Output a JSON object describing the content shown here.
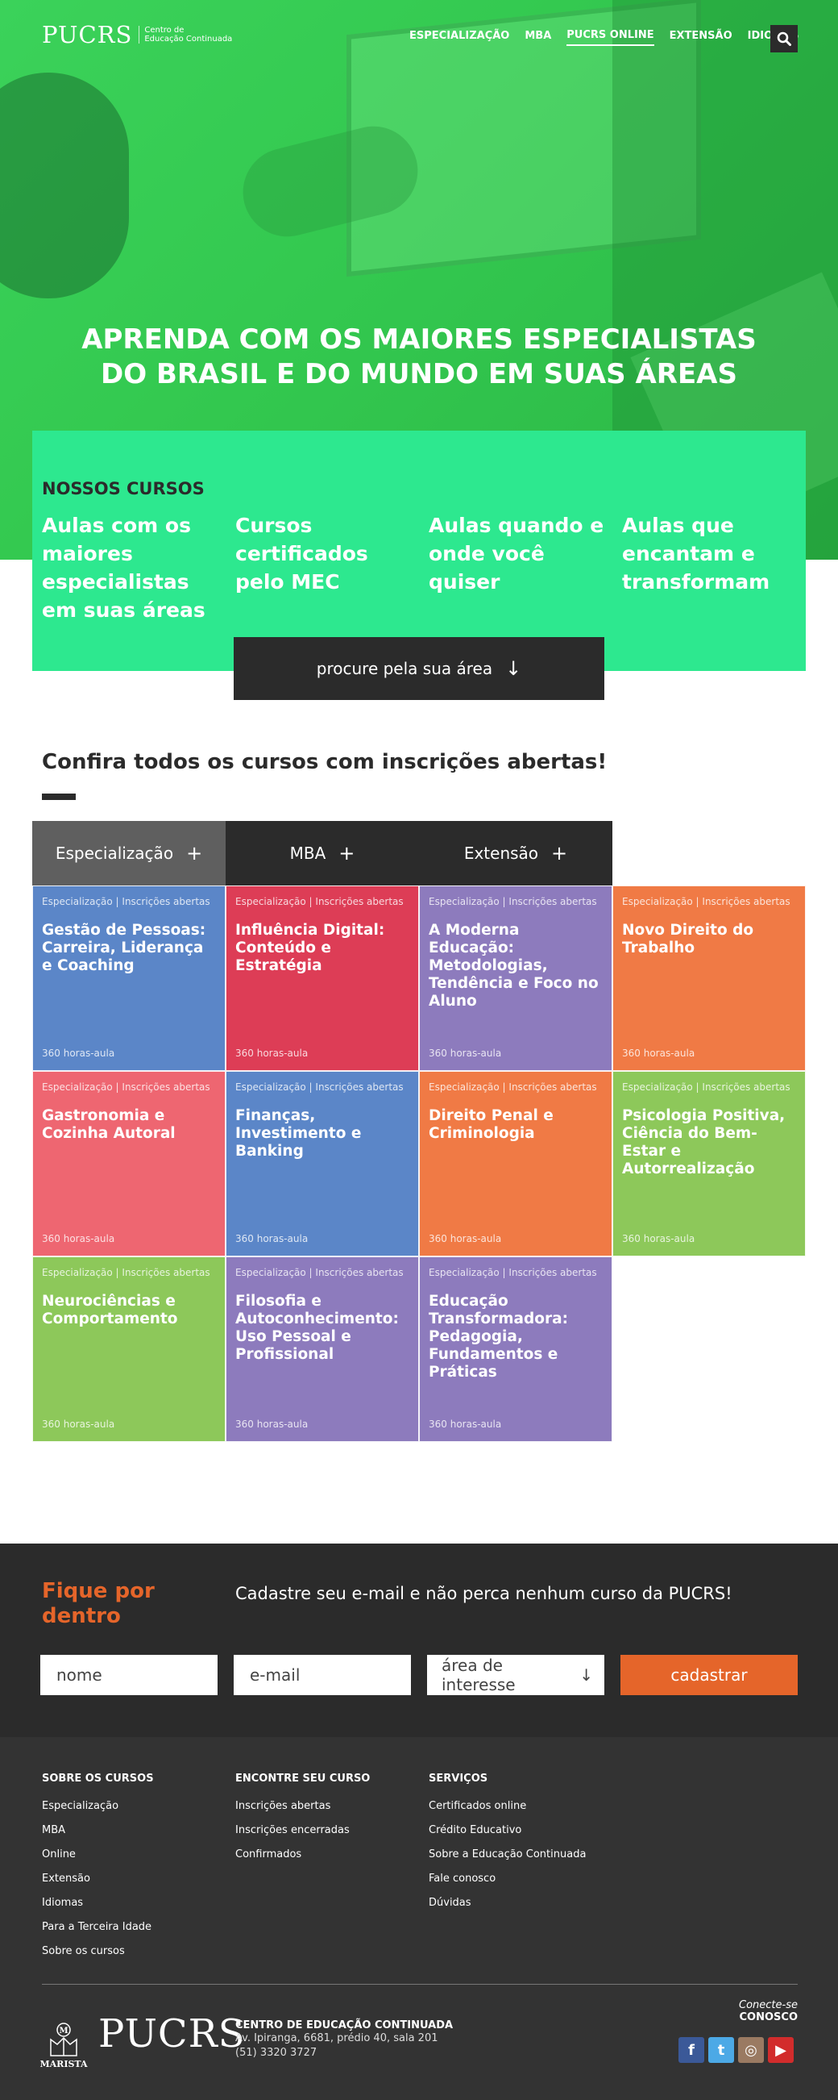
{
  "brand": {
    "name": "PUCRS",
    "sub_line1": "Centro de",
    "sub_line2": "Educação Continuada"
  },
  "nav": {
    "items": [
      "ESPECIALIZAÇÃO",
      "MBA",
      "PUCRS ONLINE",
      "EXTENSÃO",
      "IDIOMAS"
    ],
    "active": "PUCRS ONLINE",
    "search_icon": "search-icon"
  },
  "hero": {
    "line1": "APRENDA COM OS MAIORES ESPECIALISTAS",
    "line2": "DO BRASIL E DO MUNDO EM SUAS ÁREAS"
  },
  "panel": {
    "heading": "NOSSOS CURSOS",
    "features": [
      "Aulas com os maiores especialistas em suas áreas",
      "Cursos certificados pelo MEC",
      "Aulas quando e onde você quiser",
      "Aulas que encantam e transformam"
    ],
    "button_label": "procure pela sua área",
    "button_arrow": "↓"
  },
  "courses": {
    "title": "Confira todos os cursos com inscrições abertas!",
    "tabs": [
      {
        "label": "Especialização",
        "plus": "+"
      },
      {
        "label": "MBA",
        "plus": "+"
      },
      {
        "label": "Extensão",
        "plus": "+"
      }
    ],
    "category_label": "Especialização | Inscrições abertas",
    "hours_label": "360 horas-aula",
    "cards": [
      {
        "name": "Gestão de Pessoas: Carreira, Liderança e Coaching",
        "color": "#5b86c8"
      },
      {
        "name": "Influência Digital: Conteúdo e Estratégia",
        "color": "#dd3d56"
      },
      {
        "name": "A Moderna Educação: Metodologias, Tendência e Foco no Aluno",
        "color": "#8d7bbd"
      },
      {
        "name": "Novo Direito do Trabalho",
        "color": "#f07a45"
      },
      {
        "name": "Gastronomia e Cozinha Autoral",
        "color": "#ee6671"
      },
      {
        "name": "Finanças, Investimento e Banking",
        "color": "#5b86c8"
      },
      {
        "name": "Direito Penal e Criminologia",
        "color": "#f07a45"
      },
      {
        "name": "Psicologia Positiva, Ciência do Bem-Estar e Autorrealização",
        "color": "#8dc85a"
      },
      {
        "name": "Neurociências e Comportamento",
        "color": "#8dc85a"
      },
      {
        "name": "Filosofia e Autoconhecimento: Uso Pessoal e Profissional",
        "color": "#8d7bbd"
      },
      {
        "name": "Educação Transformadora: Pedagogia, Fundamentos e Práticas",
        "color": "#8d7bbd"
      }
    ]
  },
  "newsletter": {
    "title": "Fique por dentro",
    "text": "Cadastre seu e-mail e não perca nenhum curso da PUCRS!",
    "name_placeholder": "nome",
    "email_placeholder": "e-mail",
    "area_placeholder": "área de interesse",
    "area_arrow": "↓",
    "button": "cadastrar"
  },
  "footer": {
    "columns": [
      {
        "heading": "SOBRE OS CURSOS",
        "links": [
          "Especialização",
          "MBA",
          "Online",
          "Extensão",
          "Idiomas",
          "Para a Terceira Idade",
          "Sobre os cursos"
        ]
      },
      {
        "heading": "ENCONTRE SEU CURSO",
        "links": [
          "Inscrições abertas",
          "Inscrições encerradas",
          "Confirmados"
        ]
      },
      {
        "heading": "SERVIÇOS",
        "links": [
          "Certificados online",
          "Crédito Educativo",
          "Sobre a Educação Continuada",
          "Fale conosco",
          "Dúvidas"
        ]
      }
    ],
    "marista": "MARISTA",
    "logo": "PUCRS",
    "address_title": "CENTRO DE EDUCAÇÃO CONTINUADA",
    "address_line": "Av. Ipiranga, 6681, prédio 40, sala 201",
    "phone": "(51) 3320 3727",
    "connect1": "Conecte-se",
    "connect2": "CONOSCO",
    "social": [
      {
        "icon": "facebook-icon",
        "glyph": "f",
        "color": "#3b5998"
      },
      {
        "icon": "twitter-icon",
        "glyph": "t",
        "color": "#4ca9e6"
      },
      {
        "icon": "instagram-icon",
        "glyph": "◎",
        "color": "#9a7a62"
      },
      {
        "icon": "youtube-icon",
        "glyph": "▶",
        "color": "#d22c2c"
      }
    ]
  }
}
